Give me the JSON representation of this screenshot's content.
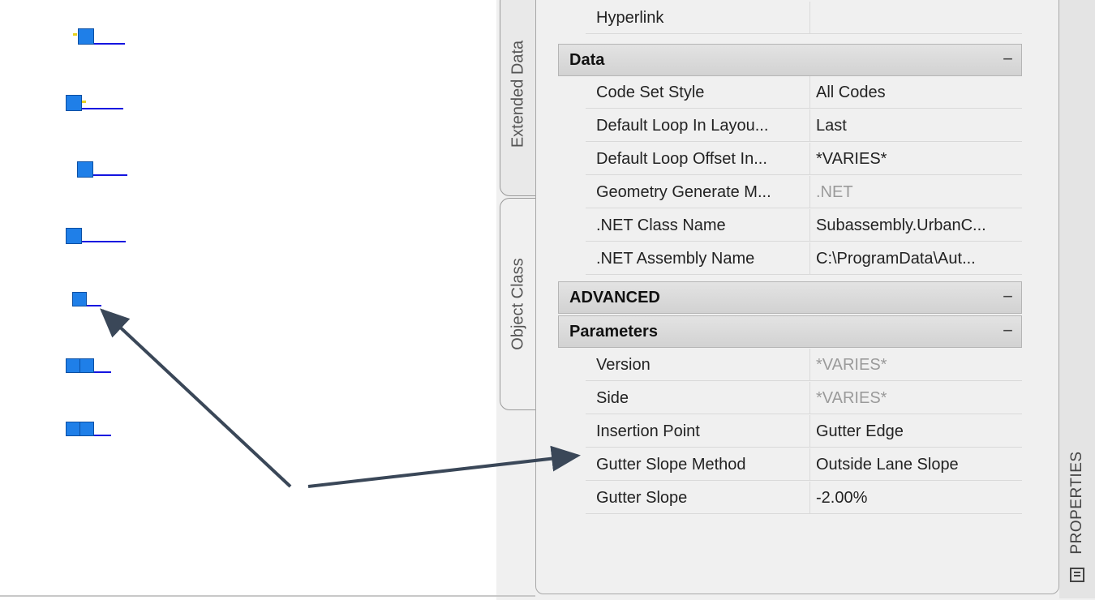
{
  "tabs": {
    "extended_data": "Extended Data",
    "object_class": "Object Class"
  },
  "palette_title": "PROPERTIES",
  "top_rows": [
    {
      "name": "Hyperlink",
      "value": ""
    }
  ],
  "sections": {
    "data": {
      "title": "Data",
      "toggle": "−"
    },
    "advanced": {
      "title": "ADVANCED",
      "toggle": "−"
    },
    "parameters": {
      "title": "Parameters",
      "toggle": "−"
    }
  },
  "data_rows": [
    {
      "name": "Code Set Style",
      "value": "All Codes"
    },
    {
      "name": "Default Loop In Layou...",
      "value": "Last"
    },
    {
      "name": "Default Loop Offset In...",
      "value": "*VARIES*"
    },
    {
      "name": "Geometry Generate M...",
      "value": ".NET"
    },
    {
      "name": ".NET Class Name",
      "value": "Subassembly.UrbanC..."
    },
    {
      "name": ".NET Assembly Name",
      "value": "C:\\ProgramData\\Aut..."
    }
  ],
  "parameter_rows": [
    {
      "name": "Version",
      "value": "*VARIES*"
    },
    {
      "name": "Side",
      "value": "*VARIES*"
    },
    {
      "name": "Insertion Point",
      "value": "Gutter Edge"
    },
    {
      "name": "Gutter Slope Method",
      "value": "Outside Lane Slope"
    },
    {
      "name": "Gutter Slope",
      "value": "-2.00%"
    }
  ],
  "colors": {
    "glyph_fill": "#1f7fe8",
    "glyph_line": "#1414e0",
    "arrow": "#3a4758"
  },
  "icons": {
    "palette_icon": "properties-palette-icon",
    "collapse": "minus-toggle-icon"
  }
}
